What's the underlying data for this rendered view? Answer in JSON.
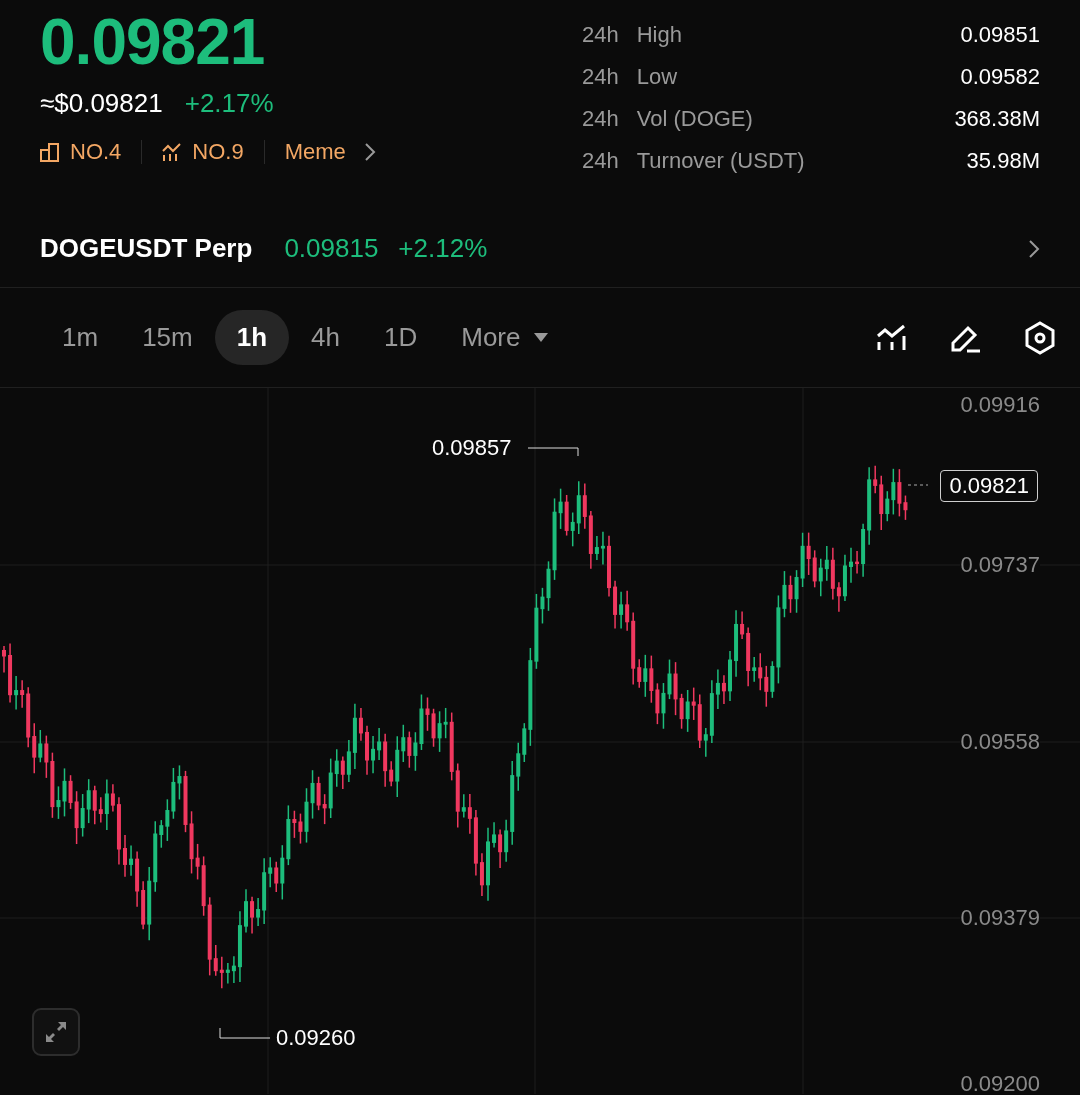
{
  "price": {
    "last": "0.09821",
    "usd": "≈$0.09821",
    "change": "+2.17%"
  },
  "tags": [
    {
      "kind": "rank",
      "label": "NO.4"
    },
    {
      "kind": "trend",
      "label": "NO.9"
    },
    {
      "kind": "category",
      "label": "Meme"
    }
  ],
  "stats": [
    {
      "period": "24h",
      "label": "High",
      "value": "0.09851"
    },
    {
      "period": "24h",
      "label": "Low",
      "value": "0.09582"
    },
    {
      "period": "24h",
      "label": "Vol (DOGE)",
      "value": "368.38M"
    },
    {
      "period": "24h",
      "label": "Turnover (USDT)",
      "value": "35.98M"
    }
  ],
  "perp": {
    "name": "DOGEUSDT Perp",
    "price": "0.09815",
    "change": "+2.12%"
  },
  "timeframes": [
    {
      "label": "1m",
      "selected": false
    },
    {
      "label": "15m",
      "selected": false
    },
    {
      "label": "1h",
      "selected": true
    },
    {
      "label": "4h",
      "selected": false
    },
    {
      "label": "1D",
      "selected": false
    }
  ],
  "more": {
    "label": "More"
  },
  "chart": {
    "y_labels": [
      "0.09916",
      "0.09737",
      "0.09558",
      "0.09379",
      "0.09200"
    ],
    "high_marker": "0.09857",
    "low_marker": "0.09260",
    "last_price_tag": "0.09821"
  }
}
